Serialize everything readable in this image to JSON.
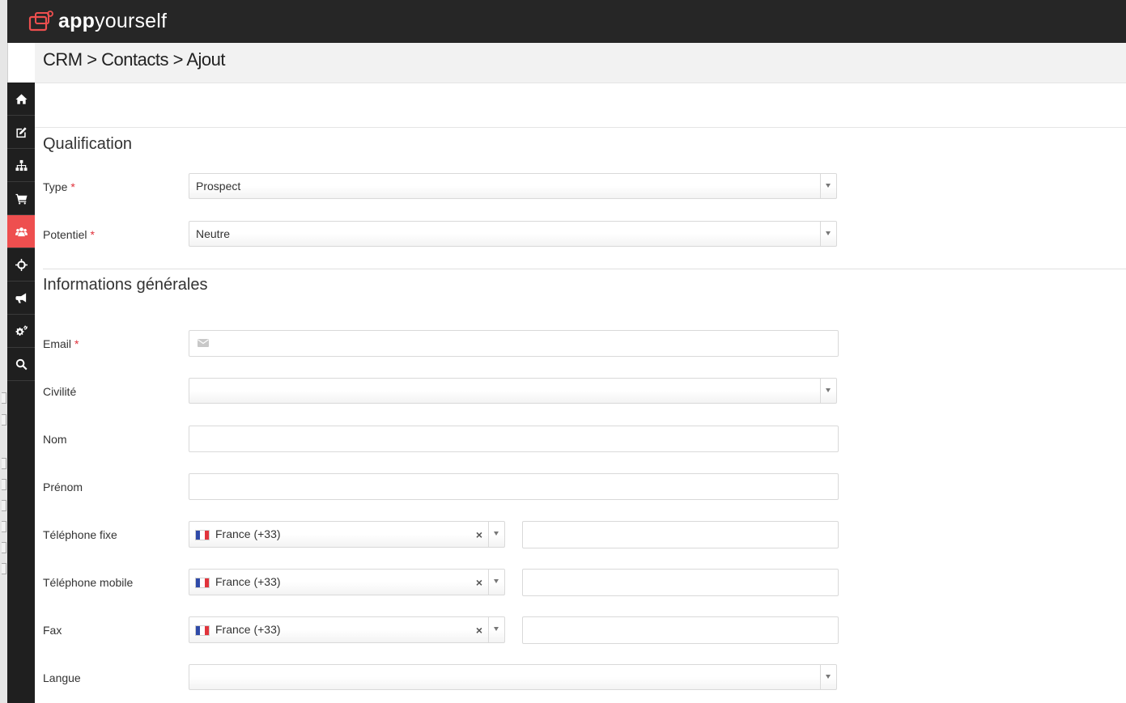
{
  "app": {
    "logo_bold": "app",
    "logo_rest": "yourself",
    "brand_color": "#ee4f4f"
  },
  "breadcrumb": "CRM > Contacts > Ajout",
  "sidebar": {
    "items": [
      {
        "icon": "home-icon"
      },
      {
        "icon": "edit-icon"
      },
      {
        "icon": "sitemap-icon"
      },
      {
        "icon": "shopping-cart-icon"
      },
      {
        "icon": "users-icon",
        "active": true
      },
      {
        "icon": "crosshair-icon"
      },
      {
        "icon": "bullhorn-icon"
      },
      {
        "icon": "cogs-icon"
      },
      {
        "icon": "search-icon"
      }
    ]
  },
  "qualification": {
    "title": "Qualification",
    "type": {
      "label": "Type",
      "required": "*",
      "value": "Prospect"
    },
    "potentiel": {
      "label": "Potentiel",
      "required": "*",
      "value": "Neutre"
    }
  },
  "general": {
    "title": "Informations générales",
    "email": {
      "label": "Email",
      "required": "*",
      "icon": "envelope-icon",
      "value": ""
    },
    "civilite": {
      "label": "Civilité",
      "value": ""
    },
    "nom": {
      "label": "Nom",
      "value": ""
    },
    "prenom": {
      "label": "Prénom",
      "value": ""
    },
    "tel_fixe": {
      "label": "Téléphone fixe",
      "country": "France (+33)",
      "clear": "×",
      "value": ""
    },
    "tel_mobile": {
      "label": "Téléphone mobile",
      "country": "France (+33)",
      "clear": "×",
      "value": ""
    },
    "fax": {
      "label": "Fax",
      "country": "France (+33)",
      "clear": "×",
      "value": ""
    },
    "langue": {
      "label": "Langue",
      "value": ""
    }
  }
}
